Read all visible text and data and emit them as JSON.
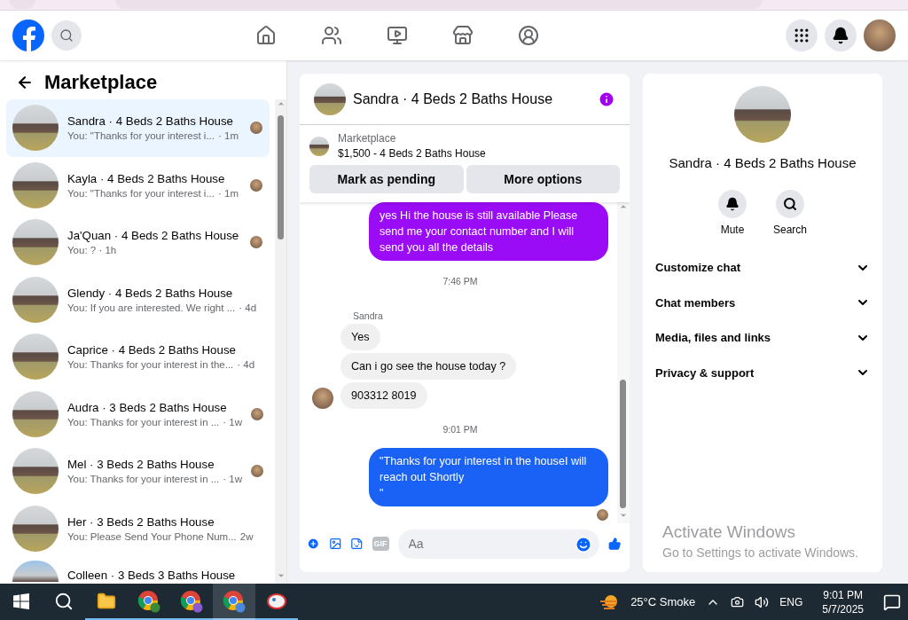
{
  "sidebar": {
    "title": "Marketplace",
    "conversations": [
      {
        "title": "Sandra · 4 Beds 2 Baths House",
        "preview": "You: \"Thanks for your interest i...",
        "time": "· 1m",
        "selected": true,
        "seen": true
      },
      {
        "title": "Kayla · 4 Beds 2 Baths House",
        "preview": "You: \"Thanks for your interest i...",
        "time": "· 1m",
        "selected": false,
        "seen": true
      },
      {
        "title": "Ja'Quan · 4 Beds 2 Baths House",
        "preview": "You: ? · 1h",
        "selected": false,
        "seen": true
      },
      {
        "title": "Glendy · 4 Beds 2 Baths House",
        "preview": "You: If you are interested. We right ...",
        "time": "· 4d",
        "selected": false,
        "seen": false
      },
      {
        "title": "Caprice · 4 Beds 2 Baths House",
        "preview": "You: Thanks for your interest in the...",
        "time": "· 4d",
        "selected": false,
        "seen": false
      },
      {
        "title": "Audra · 3 Beds 2 Baths House",
        "preview": "You: Thanks for your interest in ...",
        "time": "· 1w",
        "selected": false,
        "seen": true
      },
      {
        "title": "Mel · 3 Beds 2 Baths House",
        "preview": "You: Thanks for your interest in ...",
        "time": "· 1w",
        "selected": false,
        "seen": true
      },
      {
        "title": "Her · 3 Beds 2 Baths House",
        "preview": "You: Please Send Your Phone Num...",
        "time": "2w",
        "selected": false,
        "seen": false
      },
      {
        "title": "Colleen · 3 Beds 3 Baths House",
        "selected": false,
        "seen": false
      }
    ]
  },
  "chat": {
    "title": "Sandra · 4 Beds 2 Baths House",
    "listing": {
      "source": "Marketplace",
      "name": "$1,500 - 4 Beds 2 Baths House"
    },
    "actions": [
      "Mark as pending",
      "More options"
    ],
    "messages": [
      {
        "kind": "outgoing",
        "text": "yes Hi the house is still available Please send me your contact number and I will send you all the details",
        "color": "#9b0cf6",
        "seen": false
      },
      {
        "kind": "time",
        "text": "7:46 PM"
      },
      {
        "kind": "sender",
        "text": "Sandra"
      },
      {
        "kind": "incoming",
        "text": "Yes",
        "avatar": false
      },
      {
        "kind": "incoming",
        "text": "Can i go see the house today ?",
        "avatar": false
      },
      {
        "kind": "incoming",
        "text": "903312 8019",
        "avatar": true
      },
      {
        "kind": "time",
        "text": "9:01 PM"
      },
      {
        "kind": "outgoing",
        "text": "\"Thanks for your interest in the houseI will reach out Shortly\n\"",
        "color": "#1a62f5",
        "seen": true
      }
    ],
    "composer": {
      "gif_label": "GIF",
      "placeholder": "Aa"
    }
  },
  "info": {
    "title": "Sandra · 4 Beds 2 Baths House",
    "actions": [
      {
        "kind": "mute",
        "label": "Mute"
      },
      {
        "kind": "search",
        "label": "Search"
      }
    ],
    "sections": [
      "Customize chat",
      "Chat members",
      "Media, files and links",
      "Privacy & support"
    ]
  },
  "activation": {
    "title": "Activate Windows",
    "text": "Go to Settings to activate Windows."
  },
  "taskbar": {
    "apps": [
      {
        "kind": "folder",
        "selected": false
      },
      {
        "kind": "chrome",
        "selected": false
      },
      {
        "kind": "chrome",
        "selected": false
      },
      {
        "kind": "chrome",
        "selected": true
      },
      {
        "kind": "paint",
        "selected": false
      }
    ],
    "weather": "25°C Smoke",
    "language": "ENG",
    "time": "9:01 PM",
    "date": "5/7/2025"
  }
}
